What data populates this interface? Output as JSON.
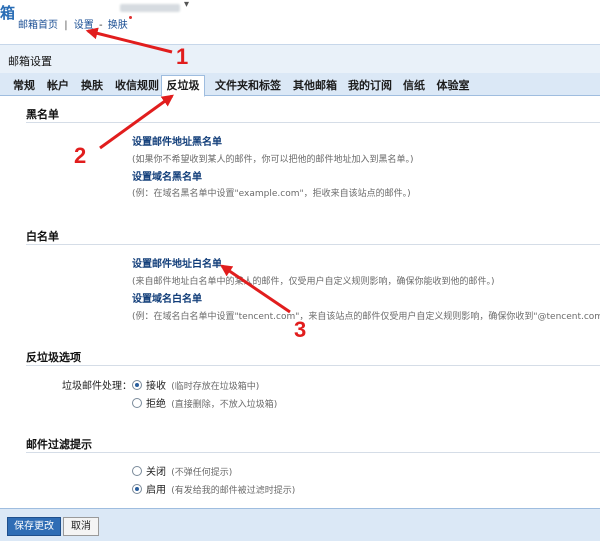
{
  "header": {
    "logo_fragment": "箱",
    "account_arrow": "▾",
    "links": {
      "home": "邮箱首页",
      "separator": "|",
      "settings": "设置",
      "dash": "-",
      "skin": "换肤"
    }
  },
  "settings": {
    "title": "邮箱设置",
    "tabs": [
      "常规",
      "帐户",
      "换肤",
      "收信规则",
      "反垃圾",
      "文件夹和标签",
      "其他邮箱",
      "我的订阅",
      "信纸",
      "体验室"
    ],
    "active_tab": "反垃圾"
  },
  "blacklist": {
    "title": "黑名单",
    "email_link": "设置邮件地址黑名单",
    "email_desc": "(如果你不希望收到某人的邮件，你可以把他的邮件地址加入到黑名单。)",
    "domain_link": "设置域名黑名单",
    "domain_desc": "(例：在域名黑名单中设置\"example.com\"，拒收来自该站点的邮件。)"
  },
  "whitelist": {
    "title": "白名单",
    "email_link": "设置邮件地址白名单",
    "email_desc": "(来自邮件地址白名单中的某人的邮件，仅受用户自定义规则影响，确保你能收到他的邮件。)",
    "domain_link": "设置域名白名单",
    "domain_desc": "(例：在域名白名单中设置\"tencent.com\"，来自该站点的邮件仅受用户自定义规则影响，确保你收到\"@tencent.com\"发来"
  },
  "antispam": {
    "title": "反垃圾选项",
    "handling_label": "垃圾邮件处理：",
    "options": [
      {
        "label": "接收",
        "note": "(临时存放在垃圾箱中)",
        "checked": true
      },
      {
        "label": "拒绝",
        "note": "(直接删除，不放入垃圾箱)",
        "checked": false
      }
    ]
  },
  "filter_tip": {
    "title": "邮件过滤提示",
    "options": [
      {
        "label": "关闭",
        "note": "(不弹任何提示)",
        "checked": false
      },
      {
        "label": "启用",
        "note": "(有发给我的邮件被过滤时提示)",
        "checked": true
      }
    ]
  },
  "footer": {
    "save": "保存更改",
    "cancel": "取消"
  },
  "annotations": {
    "color": "#e11d1d",
    "labels": [
      "1",
      "2",
      "3"
    ]
  }
}
